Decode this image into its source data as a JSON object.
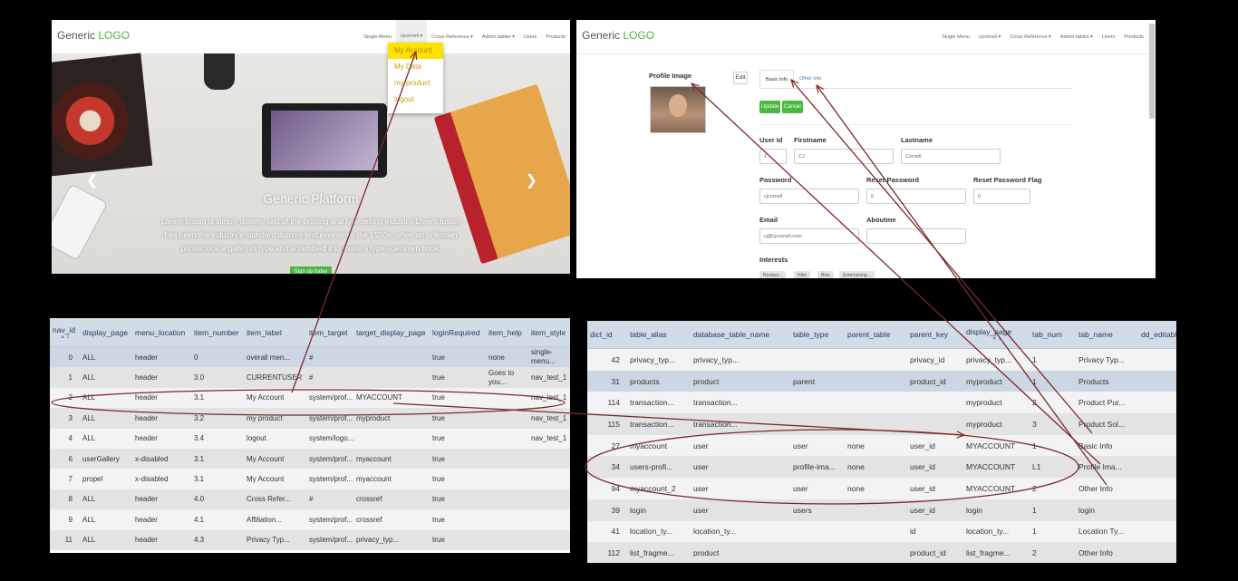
{
  "site1": {
    "logo_generic": "Generic",
    "logo_logo": "LOGO",
    "nav": [
      "Single Menu",
      "cjcornell ▾",
      "Cross Reference ▾",
      "Admin tables ▾",
      "Users",
      "Products"
    ],
    "dropdown": [
      "My Account",
      "My Data",
      "my product",
      "logout"
    ],
    "hero_title": "Generic Platform",
    "hero_text": "Lorem Ipsum is simply dummy text of the printing and typesetting industry. Lorem Ipsum has been the industry's standard dummy text ever since the 1500s, when an unknown printer took a galley of type and scrambled it to make a type specimen book.",
    "hero_button": "Sign up today"
  },
  "site2": {
    "logo_generic": "Generic",
    "logo_logo": "LOGO",
    "nav": [
      "Single Menu",
      "cjcornell ▾",
      "Cross Reference ▾",
      "Admin tables ▾",
      "Users",
      "Products"
    ],
    "profile_image_label": "Profile Image",
    "edit_button": "Edit",
    "tabs": [
      "Basic Info",
      "Other Info"
    ],
    "update_button": "Update",
    "cancel_button": "Cancel",
    "fields": {
      "user_id_label": "User Id",
      "user_id_value": "1",
      "firstname_label": "Firstname",
      "firstname_value": "CJ",
      "lastname_label": "Lastname",
      "lastname_value": "Cornell",
      "password_label": "Password",
      "password_value": "cjcornell",
      "reset_password_label": "Reset Password",
      "reset_password_value": "0",
      "reset_flag_label": "Reset Password Flag",
      "reset_flag_value": "0",
      "email_label": "Email",
      "email_value": "cj@cjcornell.com",
      "aboutme_label": "Aboutme",
      "aboutme_value": "",
      "interests_label": "Interests",
      "interests_chips": [
        "Restaur...",
        "Hike",
        "Bike",
        "Entertaining..."
      ]
    }
  },
  "grid1": {
    "headers": [
      "nav_id",
      "display_page",
      "menu_location",
      "item_number",
      "item_label",
      "item_target",
      "target_display_page",
      "loginRequired",
      "item_help",
      "item_style"
    ],
    "sort_indicator": "▲ 1",
    "rows": [
      [
        "0",
        "ALL",
        "header",
        "0",
        "overall men...",
        "#",
        "",
        "true",
        "none",
        "single-menu..."
      ],
      [
        "1",
        "ALL",
        "header",
        "3.0",
        "CURRENTUSER",
        "#",
        "",
        "true",
        "Goes to you...",
        "nav_test_1"
      ],
      [
        "2",
        "ALL",
        "header",
        "3.1",
        "My Account",
        "system/prof...",
        "MYACCOUNT",
        "true",
        "",
        "nav_test_1"
      ],
      [
        "3",
        "ALL",
        "header",
        "3.2",
        "my product",
        "system/prof...",
        "myproduct",
        "true",
        "",
        "nav_test_1"
      ],
      [
        "4",
        "ALL",
        "header",
        "3.4",
        "logout",
        "system/logo...",
        "",
        "true",
        "",
        "nav_test_1"
      ],
      [
        "6",
        "userGallery",
        "x-disabled",
        "3.1",
        "My Account",
        "system/prof...",
        "myaccount",
        "true",
        "",
        ""
      ],
      [
        "7",
        "propel",
        "x-disabled",
        "3.1",
        "My Account",
        "system/prof...",
        "myaccount",
        "true",
        "",
        ""
      ],
      [
        "8",
        "ALL",
        "header",
        "4.0",
        "Cross Refer...",
        "#",
        "crossref",
        "true",
        "",
        ""
      ],
      [
        "9",
        "ALL",
        "header",
        "4.1",
        "Affiliation...",
        "system/prof...",
        "crossref",
        "true",
        "",
        ""
      ],
      [
        "11",
        "ALL",
        "header",
        "4.3",
        "Privacy Typ...",
        "system/prof...",
        "privacy_typ...",
        "true",
        "",
        ""
      ]
    ]
  },
  "grid2": {
    "headers": [
      "dict_id",
      "table_alias",
      "database_table_name",
      "table_type",
      "parent_table",
      "parent_key",
      "display_page",
      "tab_num",
      "tab_name",
      "dd_editable"
    ],
    "sort_indicator": "▼ 1",
    "rows": [
      [
        "42",
        "privacy_typ...",
        "privacy_typ...",
        "",
        "",
        "privacy_id",
        "privacy_typ...",
        "1",
        "Privacy Typ...",
        ""
      ],
      [
        "31",
        "products",
        "product",
        "parent",
        "",
        "product_id",
        "myproduct",
        "1",
        "Products",
        ""
      ],
      [
        "114",
        "transaction...",
        "transaction...",
        "",
        "",
        "",
        "myproduct",
        "2",
        "Product Pur...",
        ""
      ],
      [
        "115",
        "transaction...",
        "transaction...",
        "",
        "",
        "",
        "myproduct",
        "3",
        "Product Sol...",
        ""
      ],
      [
        "27",
        "myaccount",
        "user",
        "user",
        "none",
        "user_id",
        "MYACCOUNT",
        "1",
        "Basic Info",
        ""
      ],
      [
        "34",
        "users-profi...",
        "user",
        "profile-ima...",
        "none",
        "user_id",
        "MYACCOUNT",
        "L1",
        "Profile Ima...",
        ""
      ],
      [
        "94",
        "myaccount_2",
        "user",
        "user",
        "none",
        "user_id",
        "MYACCOUNT",
        "2",
        "Other Info",
        ""
      ],
      [
        "39",
        "login",
        "user",
        "users",
        "",
        "user_id",
        "login",
        "1",
        "login",
        ""
      ],
      [
        "41",
        "location_ty...",
        "location_ty...",
        "",
        "",
        "id",
        "location_ty...",
        "1",
        "Location Ty...",
        ""
      ],
      [
        "112",
        "list_fragme...",
        "product",
        "",
        "",
        "product_id",
        "list_fragme...",
        "2",
        "Other Info",
        ""
      ]
    ]
  },
  "annotation_color": "#7a2a2a"
}
